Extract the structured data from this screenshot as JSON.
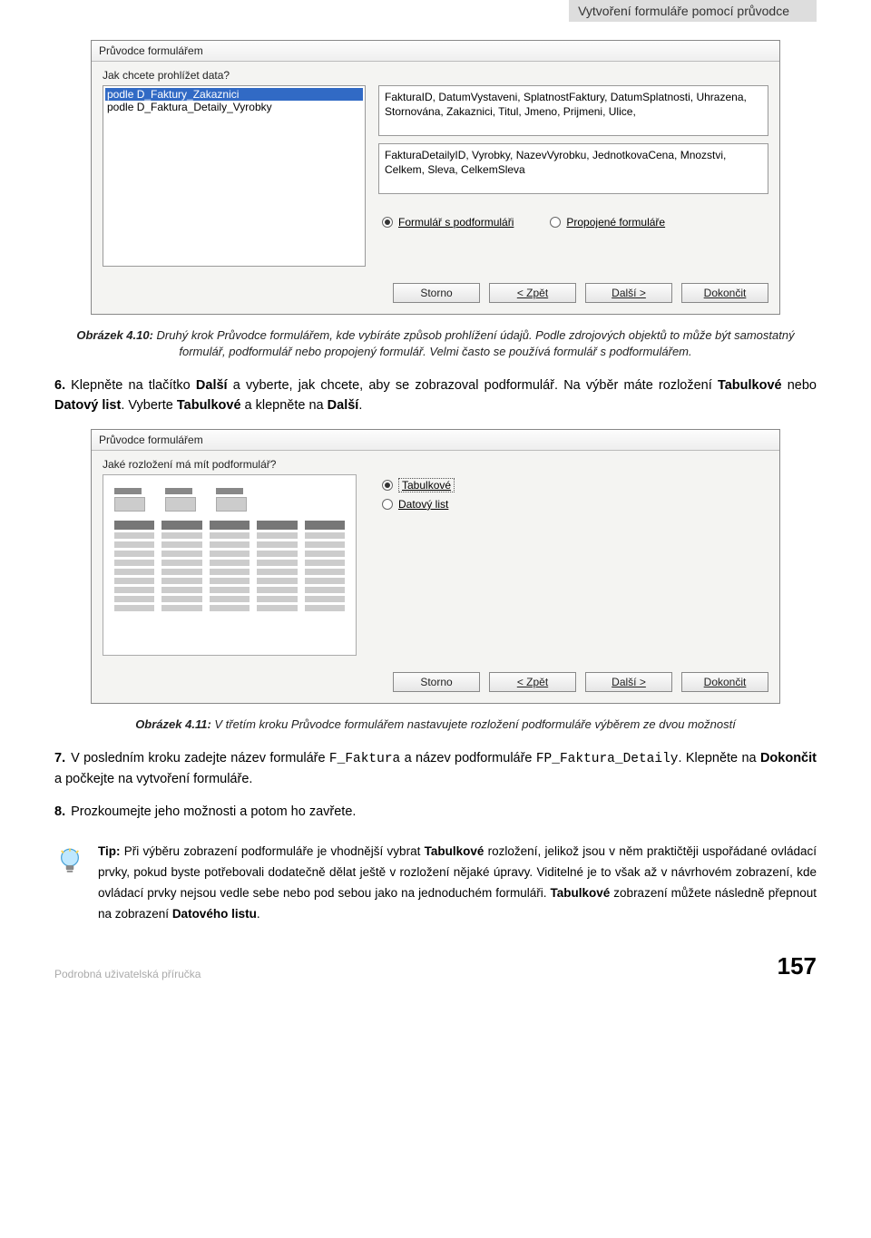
{
  "header": {
    "section_title": "Vytvoření formuláře pomocí průvodce"
  },
  "dialog1": {
    "title": "Průvodce formulářem",
    "question": "Jak chcete prohlížet data?",
    "list_items": [
      "podle D_Faktury_Zakaznici",
      "podle D_Faktura_Detaily_Vyrobky"
    ],
    "text1": "FakturaID, DatumVystaveni, SplatnostFaktury, DatumSplatnosti, Uhrazena, Stornována, Zakaznici, Titul, Jmeno, Prijmeni, Ulice,",
    "text2": "FakturaDetailyID, Vyrobky, NazevVyrobku, JednotkovaCena, Mnozstvi, Celkem, Sleva, CelkemSleva",
    "radio1": "Formulář s podformuláři",
    "radio2": "Propojené formuláře",
    "btn_cancel": "Storno",
    "btn_back": "< Zpět",
    "btn_next": "Další >",
    "btn_finish": "Dokončit"
  },
  "caption1": {
    "label": "Obrázek 4.10:",
    "text": " Druhý krok Průvodce formulářem, kde vybíráte způsob prohlížení údajů. Podle zdrojových objektů to může být samostatný formulář, podformulář nebo propojený formulář. Velmi často se používá formulář s podformulářem."
  },
  "step6": {
    "num": "6.",
    "t1": "Klepněte na tlačítko ",
    "b1": "Další",
    "t2": " a vyberte, jak chcete, aby se zobrazoval podformulář. Na výběr máte rozložení ",
    "b2": "Tabulkové",
    "t3": " nebo ",
    "b3": "Datový list",
    "t4": ". Vyberte ",
    "b4": "Tabulkové",
    "t5": " a klepněte na ",
    "b5": "Další",
    "t6": "."
  },
  "dialog2": {
    "title": "Průvodce formulářem",
    "question": "Jaké rozložení má mít podformulář?",
    "radio1": "Tabulkové",
    "radio2": "Datový list",
    "btn_cancel": "Storno",
    "btn_back": "< Zpět",
    "btn_next": "Další >",
    "btn_finish": "Dokončit"
  },
  "caption2": {
    "label": "Obrázek 4.11:",
    "text": " V třetím kroku Průvodce formulářem nastavujete rozložení podformuláře výběrem ze dvou možností"
  },
  "step7": {
    "num": "7.",
    "t1": "V posledním kroku zadejte název formuláře ",
    "c1": "F_Faktura",
    "t2": " a název podformuláře ",
    "c2": "FP_Faktura_Detaily",
    "t3": ". Klepněte na ",
    "b1": "Dokončit",
    "t4": " a počkejte na vytvoření formuláře."
  },
  "step8": {
    "num": "8.",
    "t1": "Prozkoumejte jeho možnosti a potom ho zavřete."
  },
  "tip": {
    "lead": "Tip:",
    "t1": " Při výběru zobrazení podformuláře je vhodnější vybrat ",
    "b1": "Tabulkové",
    "t2": " rozložení, jelikož jsou v něm praktičtěji uspořádané ovládací prvky, pokud byste potřebovali dodatečně dělat ještě v rozložení nějaké úpravy. Viditelné je to však až v návrhovém zobrazení, kde ovládací prvky nejsou vedle sebe nebo pod sebou jako na jednoduchém formuláři. ",
    "b2": "Tabulkové",
    "t3": " zobrazení můžete následně přepnout na zobrazení ",
    "b3": "Datového listu",
    "t4": "."
  },
  "footer": {
    "left": "Podrobná uživatelská příručka",
    "page": "157"
  }
}
